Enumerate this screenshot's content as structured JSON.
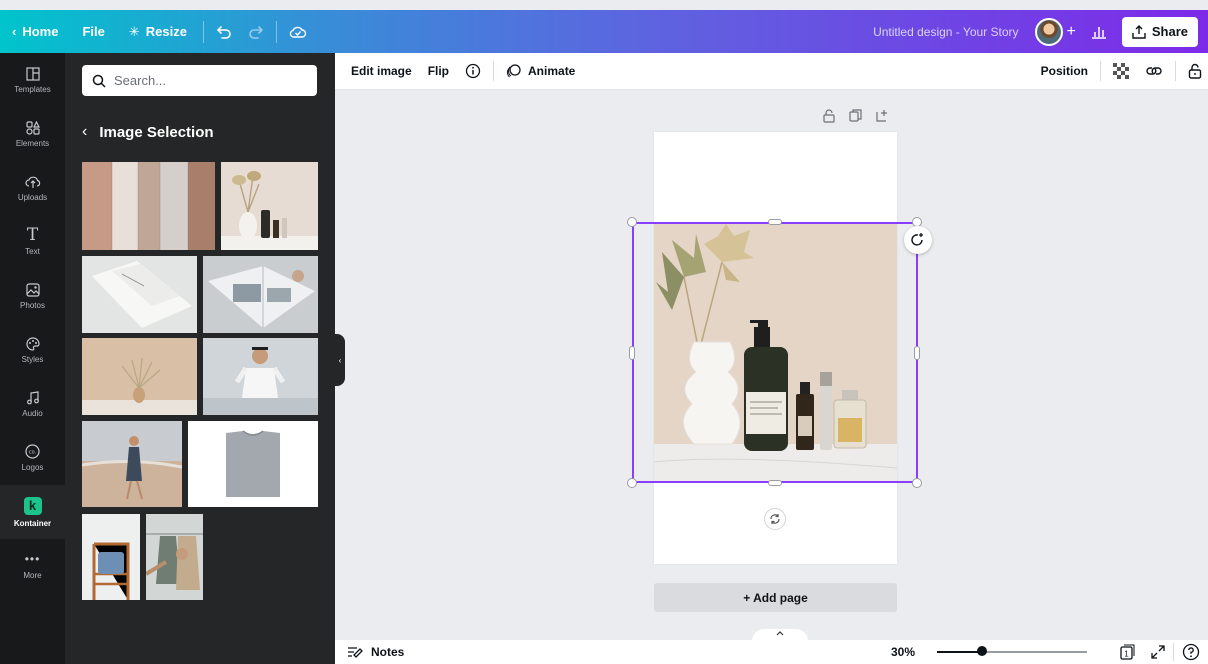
{
  "topbar": {
    "home_label": "Home",
    "file_label": "File",
    "resize_label": "Resize",
    "title": "Untitled design - Your Story",
    "share_label": "Share",
    "add_label": "+",
    "gradient_start": "#00c4cc",
    "gradient_end": "#7d2ae8"
  },
  "rail": {
    "items": [
      {
        "label": "Templates",
        "icon": "templates-icon"
      },
      {
        "label": "Elements",
        "icon": "elements-icon"
      },
      {
        "label": "Uploads",
        "icon": "uploads-icon"
      },
      {
        "label": "Text",
        "icon": "text-icon"
      },
      {
        "label": "Photos",
        "icon": "photos-icon"
      },
      {
        "label": "Styles",
        "icon": "styles-icon"
      },
      {
        "label": "Audio",
        "icon": "audio-icon"
      },
      {
        "label": "Logos",
        "icon": "logos-icon"
      },
      {
        "label": "Kontainer",
        "icon": "kontainer-logo"
      },
      {
        "label": "More",
        "icon": "more-icon"
      }
    ],
    "kontainer_letter": "k",
    "active": "Kontainer"
  },
  "panel": {
    "search_placeholder": "Search...",
    "heading": "Image Selection"
  },
  "context_toolbar": {
    "edit_image": "Edit image",
    "flip": "Flip",
    "animate": "Animate",
    "position": "Position"
  },
  "canvas": {
    "add_page": "+ Add page",
    "accent": "#8b3dff"
  },
  "bottom": {
    "notes": "Notes",
    "zoom": "30%",
    "zoom_fraction": 0.3,
    "page_count": "1"
  }
}
